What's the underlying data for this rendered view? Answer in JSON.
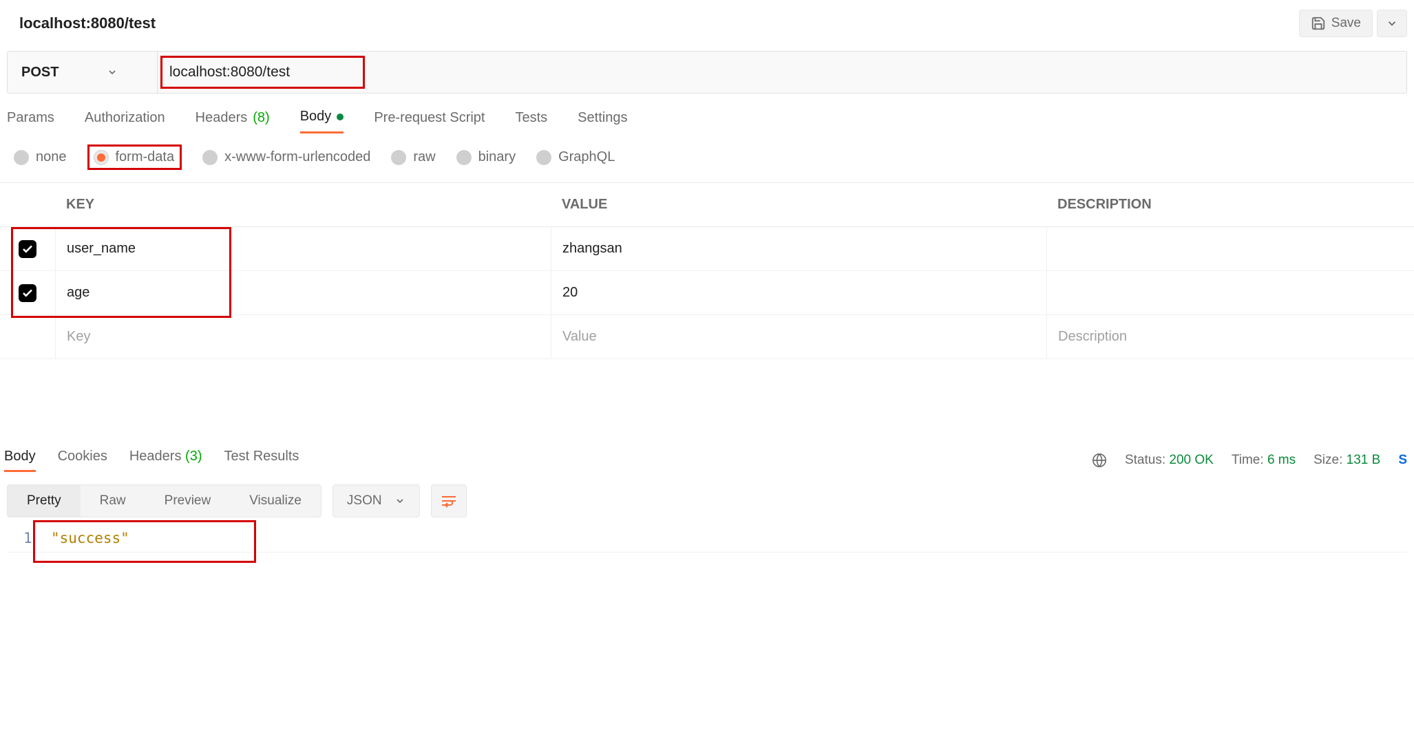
{
  "title": "localhost:8080/test",
  "save_button": {
    "label": "Save"
  },
  "request": {
    "method": "POST",
    "url": "localhost:8080/test"
  },
  "req_tabs": [
    {
      "label": "Params"
    },
    {
      "label": "Authorization"
    },
    {
      "label": "Headers",
      "count": "(8)"
    },
    {
      "label": "Body",
      "active": true,
      "has_dot": true
    },
    {
      "label": "Pre-request Script"
    },
    {
      "label": "Tests"
    },
    {
      "label": "Settings"
    }
  ],
  "body_types": [
    {
      "label": "none"
    },
    {
      "label": "form-data",
      "selected": true
    },
    {
      "label": "x-www-form-urlencoded"
    },
    {
      "label": "raw"
    },
    {
      "label": "binary"
    },
    {
      "label": "GraphQL"
    }
  ],
  "kv": {
    "headers": {
      "key": "KEY",
      "value": "VALUE",
      "description": "DESCRIPTION"
    },
    "rows": [
      {
        "checked": true,
        "key": "user_name",
        "value": "zhangsan",
        "description": ""
      },
      {
        "checked": true,
        "key": "age",
        "value": "20",
        "description": ""
      }
    ],
    "placeholder": {
      "key": "Key",
      "value": "Value",
      "description": "Description"
    }
  },
  "resp_tabs": [
    {
      "label": "Body",
      "active": true
    },
    {
      "label": "Cookies"
    },
    {
      "label": "Headers",
      "count": "(3)"
    },
    {
      "label": "Test Results"
    }
  ],
  "resp_meta": {
    "status_label": "Status:",
    "status_value": "200 OK",
    "time_label": "Time:",
    "time_value": "6 ms",
    "size_label": "Size:",
    "size_value": "131 B",
    "trailing": "S"
  },
  "resp_view": {
    "modes": [
      "Pretty",
      "Raw",
      "Preview",
      "Visualize"
    ],
    "active_mode": "Pretty",
    "format": "JSON"
  },
  "resp_body": {
    "line_no": "1",
    "text": "\"success\""
  }
}
